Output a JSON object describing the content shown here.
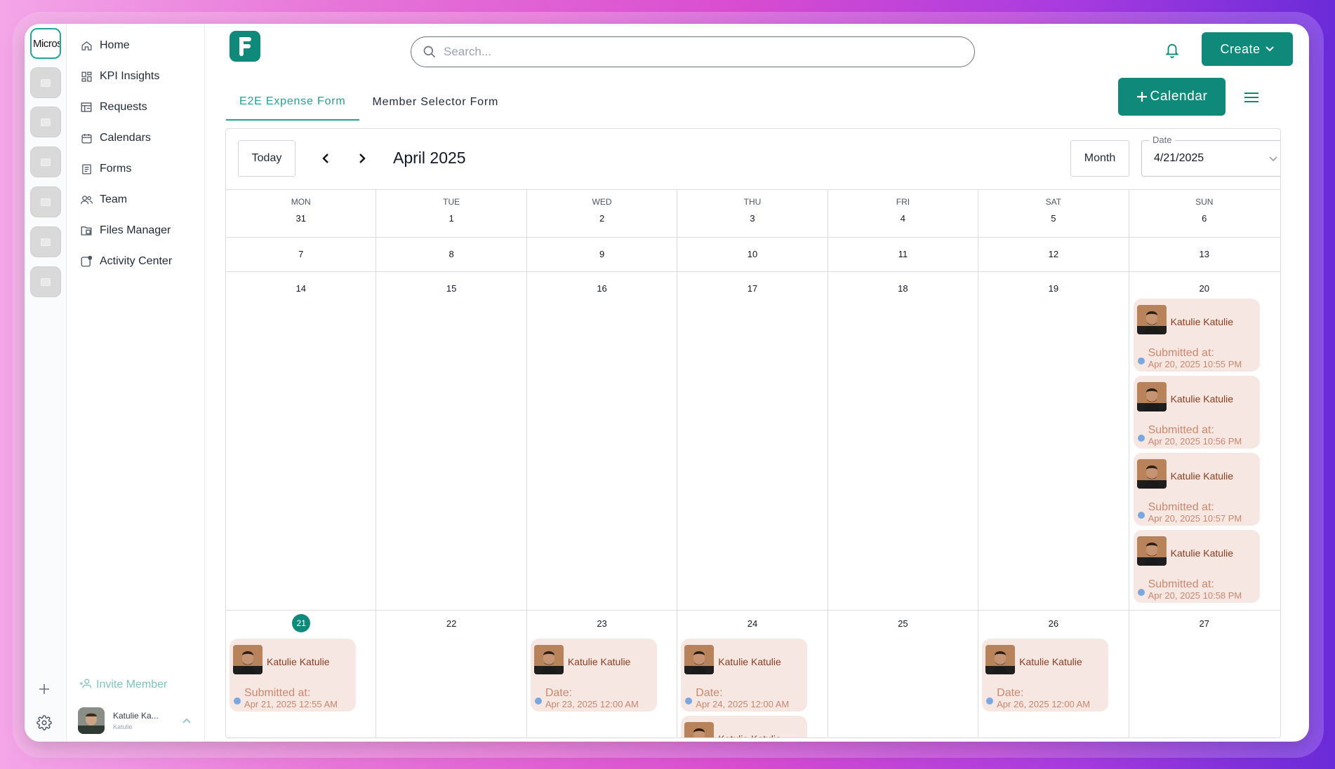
{
  "rail": {
    "active_app": "Micros"
  },
  "nav": {
    "items": [
      {
        "label": "Home",
        "icon": "home-icon"
      },
      {
        "label": "KPI Insights",
        "icon": "dashboard-icon"
      },
      {
        "label": "Requests",
        "icon": "requests-icon"
      },
      {
        "label": "Calendars",
        "icon": "calendar-icon"
      },
      {
        "label": "Forms",
        "icon": "forms-icon"
      },
      {
        "label": "Team",
        "icon": "team-icon"
      },
      {
        "label": "Files Manager",
        "icon": "files-icon"
      },
      {
        "label": "Activity Center",
        "icon": "activity-icon"
      }
    ],
    "invite": "Invite Member",
    "profile": {
      "name": "Katulie Ka...",
      "sub": "Katulie"
    }
  },
  "header": {
    "search_placeholder": "Search...",
    "create_label": "Create",
    "add_calendar_label": "Calendar"
  },
  "tabs": [
    {
      "label": "E2E Expense Form",
      "active": true
    },
    {
      "label": "Member Selector Form",
      "active": false
    }
  ],
  "calendar": {
    "today_label": "Today",
    "title": "April 2025",
    "view_label": "Month",
    "date_field_label": "Date",
    "date_value": "4/21/2025",
    "weekdays": [
      "MON",
      "TUE",
      "WED",
      "THU",
      "FRI",
      "SAT",
      "SUN"
    ],
    "weeks": [
      [
        "31",
        "1",
        "2",
        "3",
        "4",
        "5",
        "6"
      ],
      [
        "7",
        "8",
        "9",
        "10",
        "11",
        "12",
        "13"
      ],
      [
        "14",
        "15",
        "16",
        "17",
        "18",
        "19",
        "20"
      ],
      [
        "21",
        "22",
        "23",
        "24",
        "25",
        "26",
        "27"
      ]
    ],
    "today": "21",
    "events": [
      {
        "week": 2,
        "day": 6,
        "name": "Katulie Katulie",
        "label": "Submitted at:",
        "time": "Apr 20, 2025 10:55 PM"
      },
      {
        "week": 2,
        "day": 6,
        "name": "Katulie Katulie",
        "label": "Submitted at:",
        "time": "Apr 20, 2025 10:56 PM"
      },
      {
        "week": 2,
        "day": 6,
        "name": "Katulie Katulie",
        "label": "Submitted at:",
        "time": "Apr 20, 2025 10:57 PM"
      },
      {
        "week": 2,
        "day": 6,
        "name": "Katulie Katulie",
        "label": "Submitted at:",
        "time": "Apr 20, 2025 10:58 PM"
      },
      {
        "week": 3,
        "day": 0,
        "name": "Katulie Katulie",
        "label": "Submitted at:",
        "time": "Apr 21, 2025 12:55 AM"
      },
      {
        "week": 3,
        "day": 2,
        "name": "Katulie Katulie",
        "label": "Date:",
        "time": "Apr 23, 2025 12:00 AM"
      },
      {
        "week": 3,
        "day": 3,
        "name": "Katulie Katulie",
        "label": "Date:",
        "time": "Apr 24, 2025 12:00 AM"
      },
      {
        "week": 3,
        "day": 3,
        "name": "Katulie Katulie",
        "label": "",
        "time": ""
      },
      {
        "week": 3,
        "day": 5,
        "name": "Katulie Katulie",
        "label": "Date:",
        "time": "Apr 26, 2025 12:00 AM"
      }
    ]
  },
  "colors": {
    "accent": "#0f8a7a",
    "event_bg": "#f7e7e3",
    "event_text": "#8a3d1f"
  }
}
